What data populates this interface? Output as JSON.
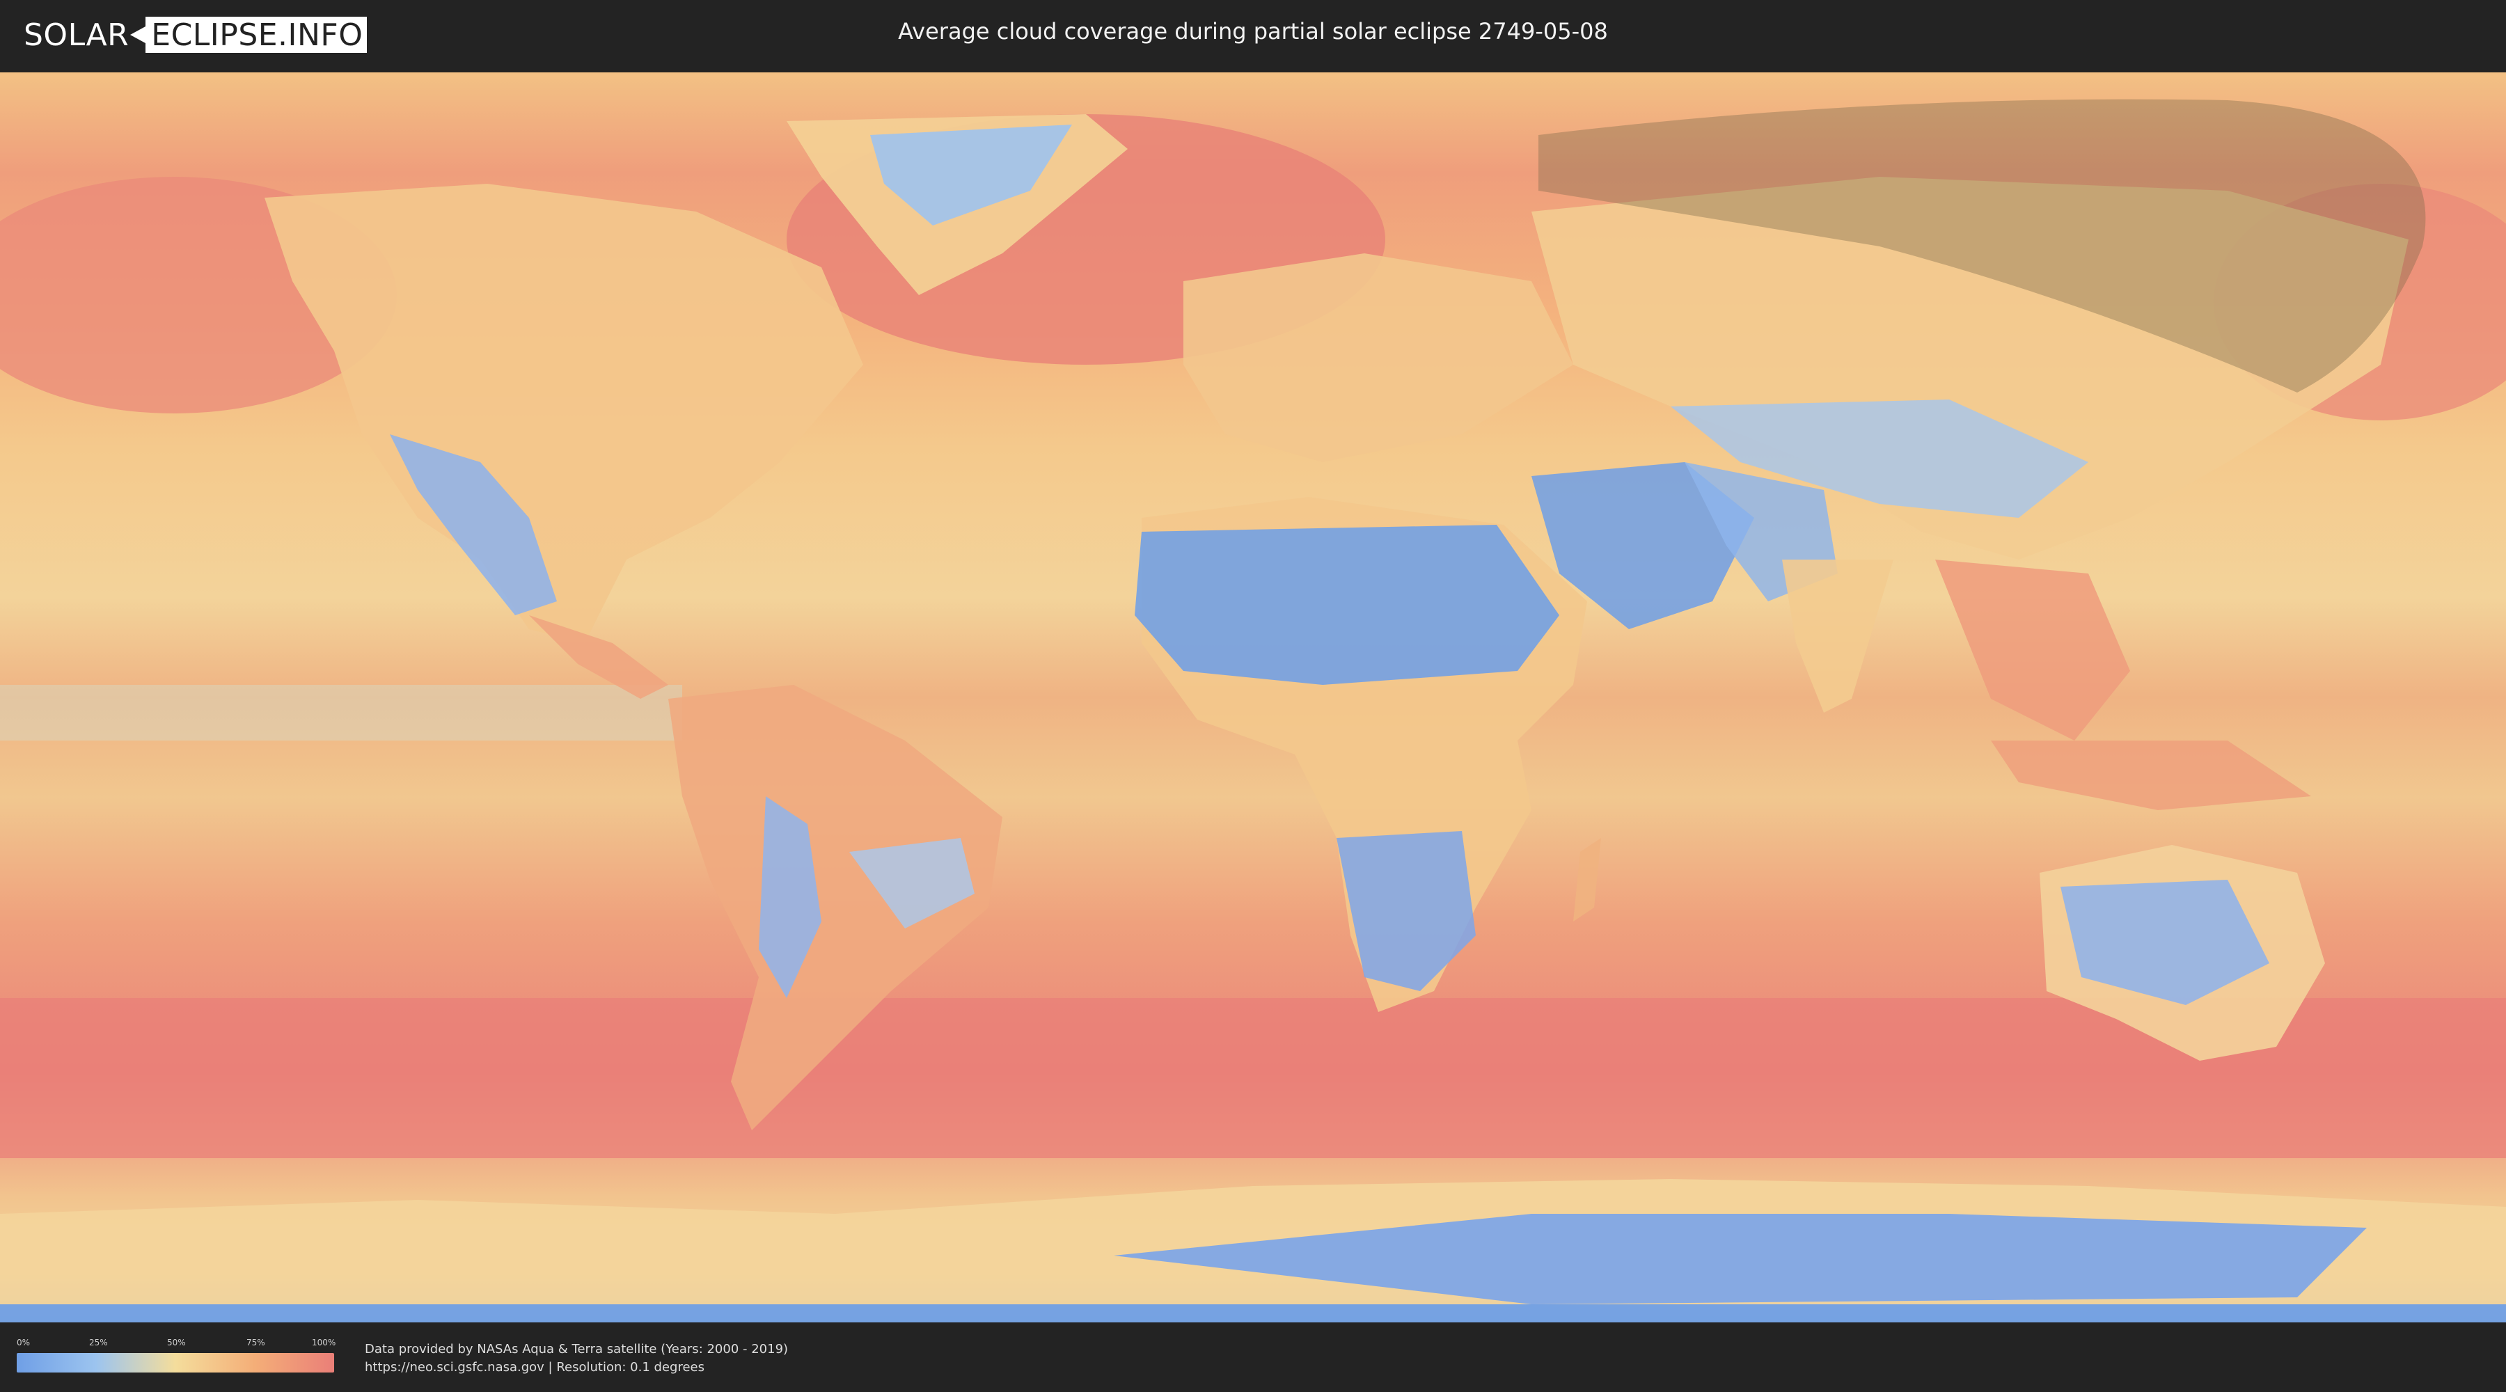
{
  "header": {
    "logo_text_left": "SOLAR",
    "logo_text_right": "ECLIPSE.INFO",
    "title": "Average cloud coverage during partial solar eclipse 2749-05-08"
  },
  "map": {
    "icon": "world-map",
    "colors": {
      "clear": "#6f9fe6",
      "low": "#9cc4ef",
      "mid": "#f4dd9c",
      "high": "#f4ae78",
      "overcast": "#ea7f78",
      "eclipse_shade": "#7b6a4a"
    }
  },
  "legend": {
    "ticks": [
      "0%",
      "25%",
      "50%",
      "75%",
      "100%"
    ],
    "gradient_colors": [
      "#6f9fe6",
      "#9cc4ef",
      "#f4dd9c",
      "#f4ae78",
      "#ea7f78"
    ]
  },
  "credits": {
    "line1": "Data provided by NASAs Aqua & Terra satellite (Years: 2000 - 2019)",
    "line2": "https://neo.sci.gsfc.nasa.gov | Resolution: 0.1 degrees"
  }
}
